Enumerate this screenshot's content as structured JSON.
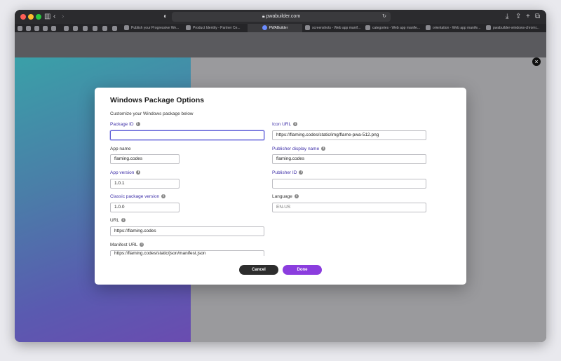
{
  "browser": {
    "url": "pwabuilder.com",
    "tabs": [
      {
        "label": "Publish your Progressive We..."
      },
      {
        "label": "Product Identity - Partner Ce..."
      },
      {
        "label": "PWABuilder"
      },
      {
        "label": "screenshots - Web app manif..."
      },
      {
        "label": "categories - Web app manife..."
      },
      {
        "label": "orientation - Web app manife..."
      },
      {
        "label": "pwabuilder-windows-chromi..."
      }
    ]
  },
  "modal": {
    "title": "Windows Package Options",
    "subtitle": "Customize your Windows package below",
    "fields": {
      "package_id": {
        "label": "Package ID",
        "value": ""
      },
      "app_name": {
        "label": "App name",
        "value": "flaming.codes"
      },
      "app_version": {
        "label": "App version",
        "value": "1.0.1"
      },
      "classic_version": {
        "label": "Classic package version",
        "value": "1.0.0"
      },
      "url": {
        "label": "URL",
        "value": "https://flaming.codes"
      },
      "manifest_url": {
        "label": "Manifest URL",
        "value": "https://flaming.codes/static/json/manifest.json"
      },
      "icon_url": {
        "label": "Icon URL",
        "value": "https://flaming.codes/static/img/flame-pwa-512.png"
      },
      "publisher_display_name": {
        "label": "Publisher display name",
        "value": "flaming.codes"
      },
      "publisher_id": {
        "label": "Publisher ID",
        "value": ""
      },
      "language": {
        "label": "Language",
        "placeholder": "EN-US"
      }
    },
    "buttons": {
      "cancel": "Cancel",
      "done": "Done"
    }
  },
  "icons": {
    "info": "i",
    "close": "×"
  }
}
